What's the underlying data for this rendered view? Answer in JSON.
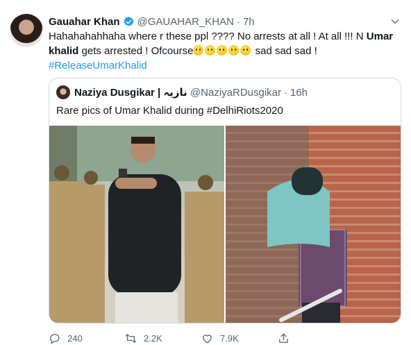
{
  "tweet": {
    "display_name": "Gauahar Khan",
    "handle": "@GAUAHAR_KHAN",
    "separator": "·",
    "time": "7h",
    "text_part1": "Hahahahahhaha where r these ppl ???? No arrests at all ! At all !!! N ",
    "text_bold": "Umar khalid",
    "text_part2": " gets arrested ! Ofcourse",
    "text_part3": " sad sad sad !",
    "hashtag": "#ReleaseUmarKhalid",
    "emoji_count": 5
  },
  "quoted": {
    "display_name": "Naziya Dusgikar | نازیہ",
    "handle": "@NaziyaRDusgikar",
    "separator": "·",
    "time": "16h",
    "text": "Rare pics of Umar Khalid during #DelhiRiots2020"
  },
  "actions": {
    "replies": "240",
    "retweets": "2.2K",
    "likes": "7.9K"
  },
  "colors": {
    "accent": "#1d9bf0",
    "muted": "#536471",
    "border": "#cfd9de"
  },
  "icons": [
    "verified-badge-icon",
    "caret-down-icon",
    "reply-icon",
    "retweet-icon",
    "like-icon",
    "share-icon"
  ]
}
